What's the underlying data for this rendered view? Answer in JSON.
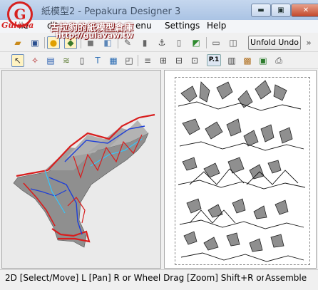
{
  "window": {
    "title": "紙模型2 - Pepakura Designer 3",
    "buttons": {
      "minimize": "▬",
      "maximize": "▣",
      "close": "✕"
    }
  },
  "watermark": {
    "logo_letter": "G",
    "logo_text": "Gulawa",
    "name": "古拉豹的紙模型倉庫",
    "url": "http://gulavaw.tw"
  },
  "menu": {
    "items": [
      "ile",
      "dit",
      "enu",
      "Settings",
      "Help"
    ]
  },
  "toolbar1": {
    "unfold_button": "Unfold Undo"
  },
  "toolbar2": {
    "page_button": "P.1"
  },
  "colors": {
    "fold_mountain": "#d81e1e",
    "fold_valley": "#1e3fd8",
    "fold_flat": "#33c6ff",
    "model_fill": "#8f8f8f"
  },
  "statusbar": {
    "text": "2D [Select/Move] L [Pan] R or Wheel Drag [Zoom] Shift+R or W",
    "mode": "Assemble"
  }
}
